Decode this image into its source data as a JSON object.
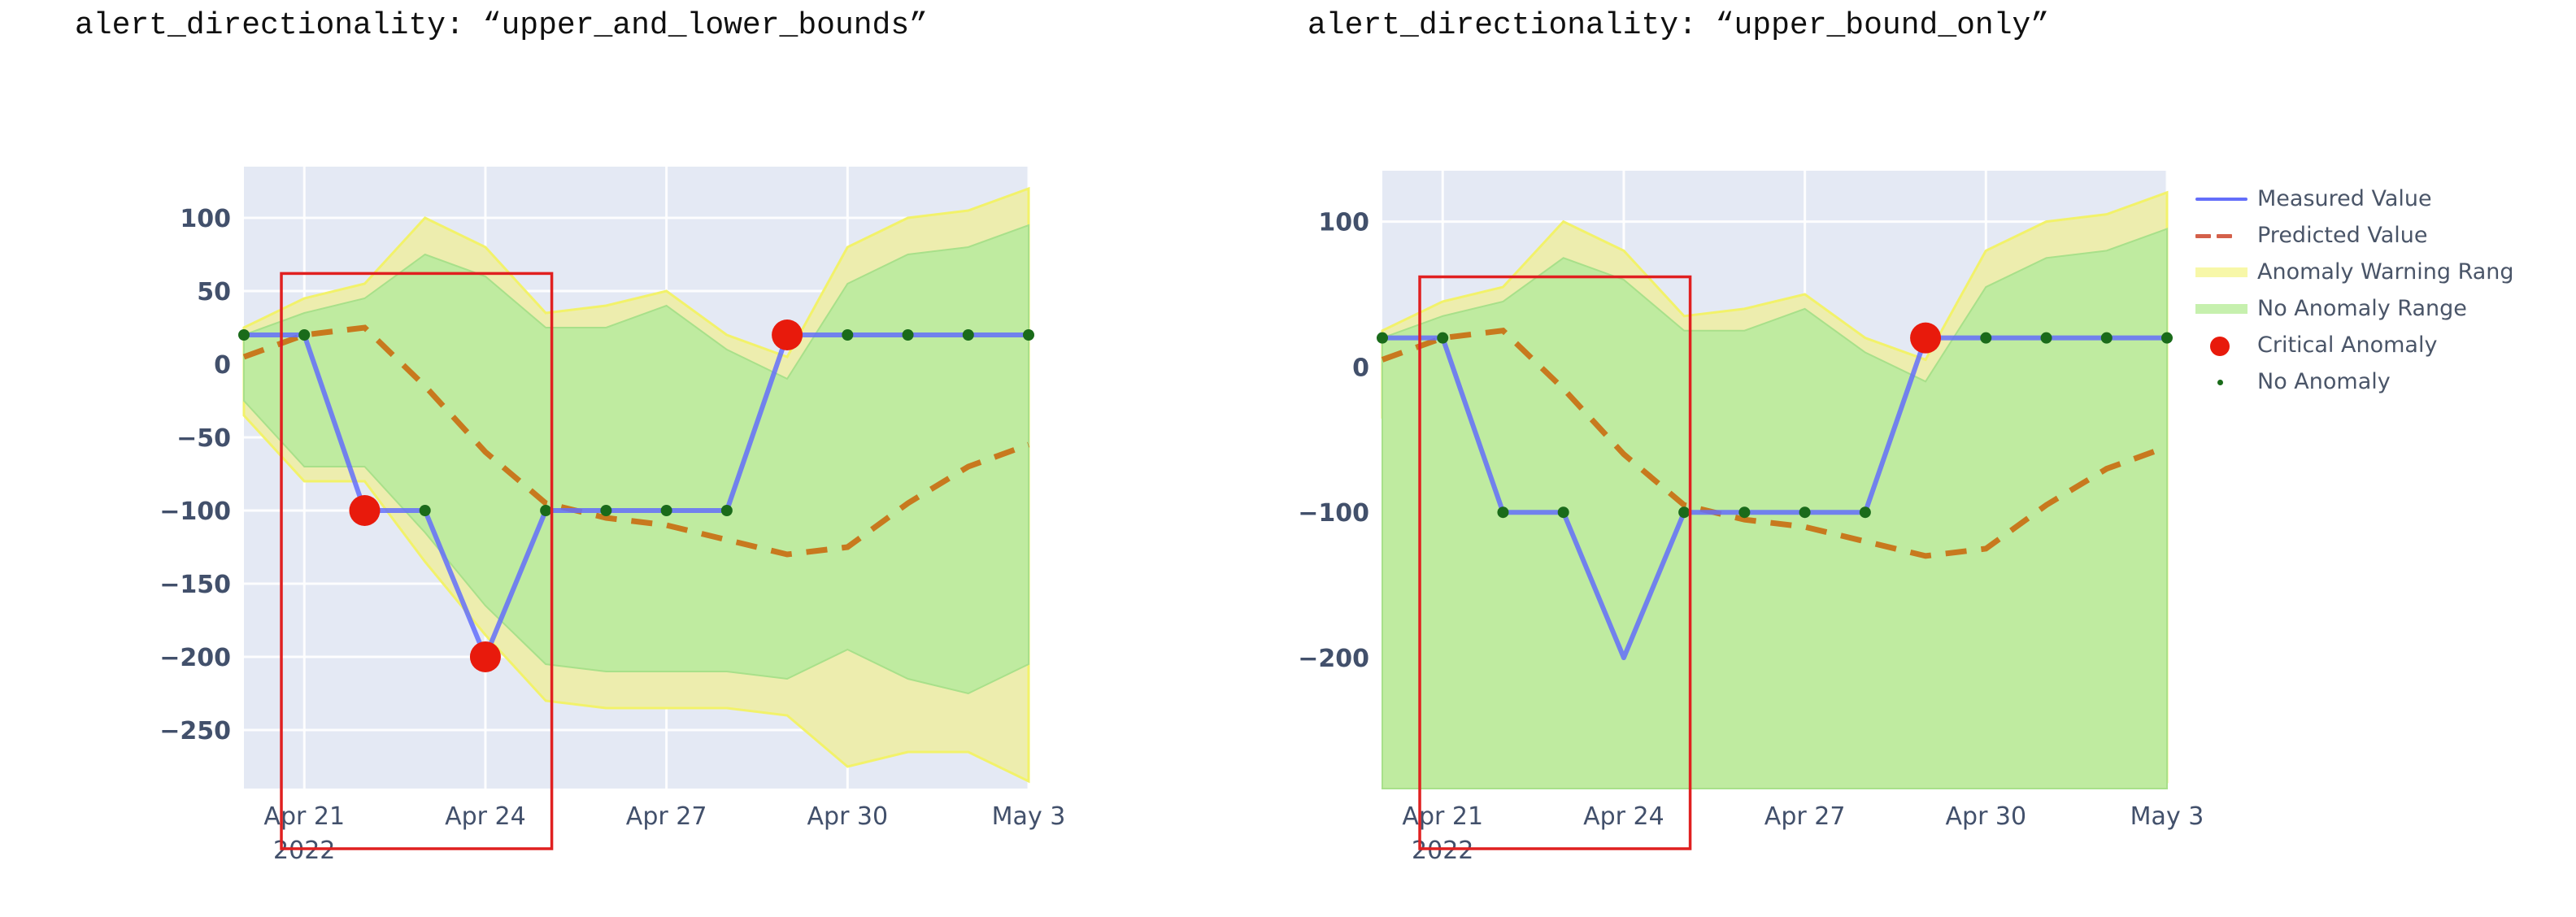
{
  "panels": [
    {
      "id": "left",
      "title": "alert_directionality: “upper_and_lower_bounds”"
    },
    {
      "id": "right",
      "title": "alert_directionality: “upper_bound_only”"
    }
  ],
  "legend": {
    "position": "right",
    "items": [
      {
        "label": "Measured Value",
        "marker": "solid-line",
        "icon": "line-icon",
        "color": "#636EFA"
      },
      {
        "label": "Predicted Value",
        "marker": "dashed-line",
        "icon": "dashed-line-icon",
        "color": "#D4604A"
      },
      {
        "label": "Anomaly Warning Rang",
        "marker": "band",
        "icon": "band-swatch-icon",
        "color": "#F7F7A8"
      },
      {
        "label": "No Anomaly Range",
        "marker": "band",
        "icon": "band-swatch-icon",
        "color": "#C6F0AE"
      },
      {
        "label": "Critical Anomaly",
        "marker": "big-dot",
        "icon": "circle-marker-icon",
        "color": "#E81A0C"
      },
      {
        "label": "No Anomaly",
        "marker": "small-dot",
        "icon": "dot-marker-icon",
        "color": "#1A6B1A"
      }
    ]
  },
  "colors": {
    "plot_background": "#E4E9F4",
    "gridline": "#F7F9FD",
    "measured_line": "#636EFA",
    "predicted_line": "#C8791E",
    "no_anomaly_band": "#BFEBA0",
    "warning_band": "#EDEDAE",
    "warning_band_edge": "#F2F26A",
    "critical_anomaly": "#E81A0C",
    "no_anomaly_marker": "#1A6B1A",
    "alert_box": "#E02020",
    "tick_text": "#42506B",
    "title_text": "#101010"
  },
  "chart_data": [
    {
      "type": "line",
      "title": "alert_directionality: “upper_and_lower_bounds”",
      "xlabel": "",
      "ylabel": "",
      "grid": true,
      "ylim": [
        -290,
        135
      ],
      "yticks": [
        100,
        50,
        0,
        -50,
        -100,
        -150,
        -200,
        -250
      ],
      "ytick_labels": [
        "100",
        "50",
        "0",
        "−50",
        "−100",
        "−150",
        "−200",
        "−250"
      ],
      "xlim": [
        "2022-04-20",
        "2022-05-04"
      ],
      "xticks": [
        "Apr 21",
        "Apr 24",
        "Apr 27",
        "Apr 30",
        "May 3"
      ],
      "xtick_sublabel": "2022",
      "x": [
        "Apr 20",
        "Apr 21",
        "Apr 22",
        "Apr 23",
        "Apr 24",
        "Apr 25",
        "Apr 26",
        "Apr 27",
        "Apr 28",
        "Apr 29",
        "Apr 30",
        "May 1",
        "May 2",
        "May 3"
      ],
      "series": [
        {
          "name": "Measured Value",
          "values": [
            20,
            20,
            -100,
            -100,
            -200,
            -100,
            -100,
            -100,
            -100,
            20,
            20,
            20,
            20,
            20
          ]
        },
        {
          "name": "Predicted Value",
          "values": [
            5,
            20,
            25,
            -15,
            -60,
            -95,
            -105,
            -110,
            -120,
            -130,
            -125,
            -95,
            -70,
            -55
          ]
        },
        {
          "name": "No Anomaly Range upper",
          "values": [
            20,
            35,
            45,
            75,
            60,
            25,
            25,
            40,
            10,
            -10,
            55,
            75,
            80,
            95
          ]
        },
        {
          "name": "No Anomaly Range lower",
          "values": [
            -25,
            -70,
            -70,
            -115,
            -165,
            -205,
            -210,
            -210,
            -210,
            -215,
            -195,
            -215,
            -225,
            -205
          ]
        },
        {
          "name": "Anomaly Warning Range upper",
          "values": [
            25,
            45,
            55,
            100,
            80,
            35,
            40,
            50,
            20,
            5,
            80,
            100,
            105,
            120
          ]
        },
        {
          "name": "Anomaly Warning Range lower",
          "values": [
            -35,
            -80,
            -80,
            -135,
            -185,
            -230,
            -235,
            -235,
            -235,
            -240,
            -275,
            -265,
            -265,
            -285
          ]
        }
      ],
      "critical_anomalies": [
        {
          "x": "Apr 22",
          "y": -100
        },
        {
          "x": "Apr 24",
          "y": -200
        },
        {
          "x": "Apr 29",
          "y": 20
        }
      ],
      "no_anomaly_points": [
        {
          "x": "Apr 20",
          "y": 20
        },
        {
          "x": "Apr 21",
          "y": 20
        },
        {
          "x": "Apr 23",
          "y": -100
        },
        {
          "x": "Apr 25",
          "y": -100
        },
        {
          "x": "Apr 26",
          "y": -100
        },
        {
          "x": "Apr 27",
          "y": -100
        },
        {
          "x": "Apr 28",
          "y": -100
        },
        {
          "x": "Apr 30",
          "y": 20
        },
        {
          "x": "May 1",
          "y": 20
        },
        {
          "x": "May 2",
          "y": 20
        },
        {
          "x": "May 3",
          "y": 20
        }
      ],
      "alert_box": {
        "x0": "Apr 20.6",
        "x1": "Apr 25.1",
        "y0": -290,
        "y1": 62
      }
    },
    {
      "type": "line",
      "title": "alert_directionality: “upper_bound_only”",
      "xlabel": "",
      "ylabel": "",
      "grid": true,
      "ylim": [
        -290,
        135
      ],
      "yticks": [
        100,
        0,
        -100,
        -200
      ],
      "ytick_labels": [
        "100",
        "0",
        "−100",
        "−200"
      ],
      "xlim": [
        "2022-04-20",
        "2022-05-04"
      ],
      "xticks": [
        "Apr 21",
        "Apr 24",
        "Apr 27",
        "Apr 30",
        "May 3"
      ],
      "xtick_sublabel": "2022",
      "x": [
        "Apr 20",
        "Apr 21",
        "Apr 22",
        "Apr 23",
        "Apr 24",
        "Apr 25",
        "Apr 26",
        "Apr 27",
        "Apr 28",
        "Apr 29",
        "Apr 30",
        "May 1",
        "May 2",
        "May 3"
      ],
      "series": [
        {
          "name": "Measured Value",
          "values": [
            20,
            20,
            -100,
            -100,
            -200,
            -100,
            -100,
            -100,
            -100,
            20,
            20,
            20,
            20,
            20
          ]
        },
        {
          "name": "Predicted Value",
          "values": [
            5,
            20,
            25,
            -15,
            -60,
            -95,
            -105,
            -110,
            -120,
            -130,
            -125,
            -95,
            -70,
            -55
          ]
        },
        {
          "name": "No Anomaly Range upper",
          "values": [
            20,
            35,
            45,
            75,
            60,
            25,
            25,
            40,
            10,
            -10,
            55,
            75,
            80,
            95
          ]
        },
        {
          "name": "No Anomaly Range lower",
          "values": [
            -290,
            -290,
            -290,
            -290,
            -290,
            -290,
            -290,
            -290,
            -290,
            -290,
            -290,
            -290,
            -290,
            -290
          ]
        },
        {
          "name": "Anomaly Warning Range upper",
          "values": [
            25,
            45,
            55,
            100,
            80,
            35,
            40,
            50,
            20,
            5,
            80,
            100,
            105,
            120
          ]
        },
        {
          "name": "Anomaly Warning Range lower",
          "values": [
            -35,
            -80,
            -80,
            -135,
            -185,
            -230,
            -235,
            -235,
            -235,
            -240,
            -275,
            -265,
            -265,
            -285
          ]
        }
      ],
      "critical_anomalies": [
        {
          "x": "Apr 29",
          "y": 20
        }
      ],
      "no_anomaly_points": [
        {
          "x": "Apr 20",
          "y": 20
        },
        {
          "x": "Apr 21",
          "y": 20
        },
        {
          "x": "Apr 22",
          "y": -100
        },
        {
          "x": "Apr 23",
          "y": -100
        },
        {
          "x": "Apr 25",
          "y": -100
        },
        {
          "x": "Apr 26",
          "y": -100
        },
        {
          "x": "Apr 27",
          "y": -100
        },
        {
          "x": "Apr 28",
          "y": -100
        },
        {
          "x": "Apr 30",
          "y": 20
        },
        {
          "x": "May 1",
          "y": 20
        },
        {
          "x": "May 2",
          "y": 20
        },
        {
          "x": "May 3",
          "y": 20
        }
      ],
      "alert_box": {
        "x0": "Apr 20.6",
        "x1": "Apr 25.1",
        "y0": -290,
        "y1": 62
      }
    }
  ]
}
